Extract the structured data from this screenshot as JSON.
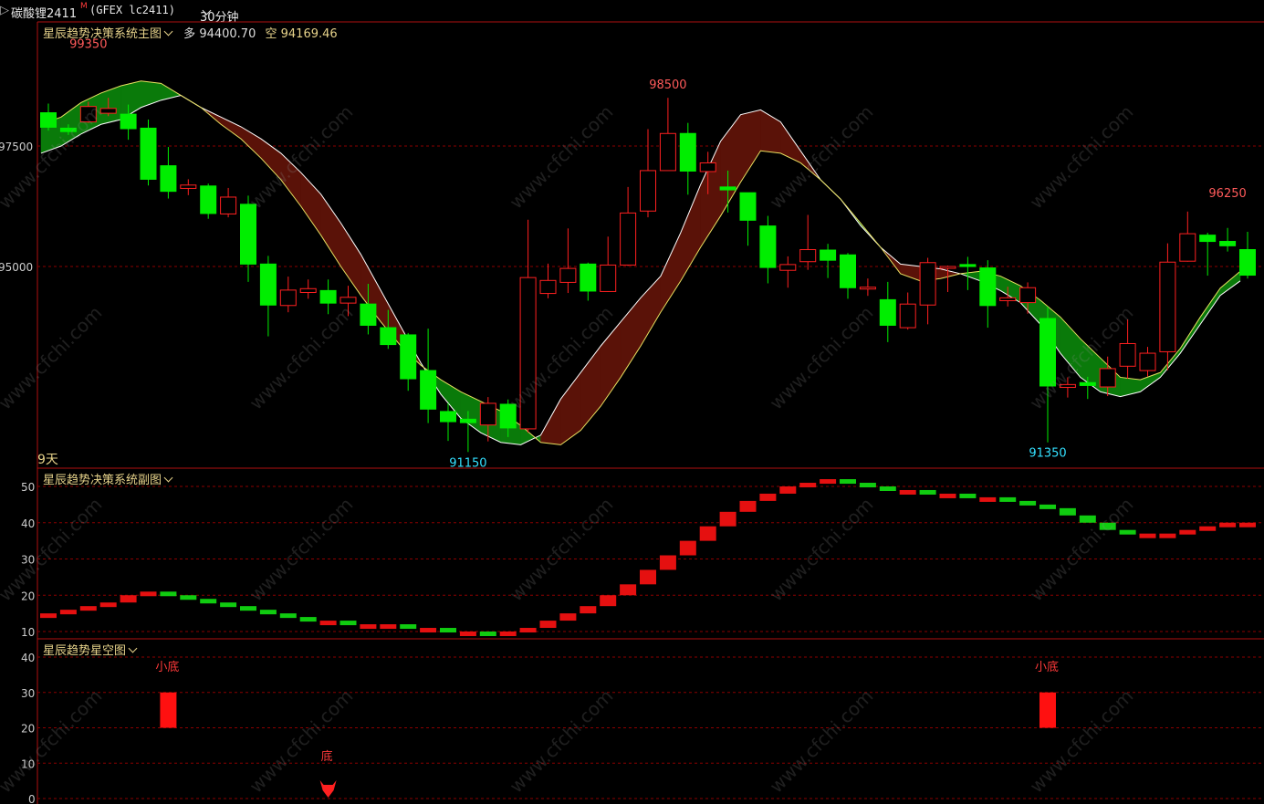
{
  "header": {
    "instrument": "碳酸锂2411",
    "badge": "M",
    "code": "(GFEX lc2411)",
    "period": "30分钟"
  },
  "main_panel": {
    "title": "星辰趋势决策系统主图",
    "long_label": "多",
    "long_value": "94400.70",
    "short_label": "空",
    "short_value": "94169.46",
    "corner_label": "9天",
    "y_labels": [
      "97500",
      "95000"
    ]
  },
  "sub_panel": {
    "title": "星辰趋势决策系统副图",
    "y_labels": [
      "50",
      "40",
      "30",
      "20",
      "10"
    ]
  },
  "star_panel": {
    "title": "星辰趋势星空图",
    "y_labels": [
      "40",
      "30",
      "20",
      "10",
      "0"
    ],
    "signals": [
      {
        "label": "小底",
        "value": 20
      },
      {
        "label": "小底",
        "value": 20
      }
    ],
    "bottom_signal": "底"
  },
  "watermark": "www.cfchi.com",
  "colors": {
    "up": "#ff2020",
    "down": "#00ee00",
    "bull_cloud": "#5a1208",
    "bear_cloud": "#0a7a0a",
    "grid": "#8b0000",
    "annotation_high": "#ff5a5a",
    "annotation_low": "#33e0ff",
    "title": "#e6d28a"
  },
  "chart_data": {
    "type": "candlestick",
    "y_range": [
      89500,
      100500
    ],
    "annotations": [
      {
        "label": "99350",
        "value": 99350,
        "kind": "high"
      },
      {
        "label": "91150",
        "value": 91150,
        "kind": "low"
      },
      {
        "label": "98500",
        "value": 98500,
        "kind": "high"
      },
      {
        "label": "91350",
        "value": 91350,
        "kind": "low"
      },
      {
        "label": "96250",
        "value": 96250,
        "kind": "high"
      }
    ],
    "candles": [
      [
        98200,
        97880,
        98380,
        97820
      ],
      [
        97880,
        97790,
        97950,
        97730
      ],
      [
        98000,
        98320,
        98420,
        97980
      ],
      [
        98180,
        98280,
        98500,
        98120
      ],
      [
        98170,
        97850,
        98360,
        97630
      ],
      [
        97880,
        96800,
        98050,
        96680
      ],
      [
        97100,
        96550,
        97480,
        96410
      ],
      [
        96620,
        96690,
        96810,
        96480
      ],
      [
        96680,
        96090,
        96720,
        95990
      ],
      [
        96090,
        96440,
        96630,
        96020
      ],
      [
        96300,
        95040,
        96470,
        94680
      ],
      [
        95060,
        94190,
        95220,
        93550
      ],
      [
        94190,
        94510,
        94790,
        94050
      ],
      [
        94460,
        94540,
        94730,
        94330
      ],
      [
        94510,
        94230,
        94730,
        94010
      ],
      [
        94240,
        94360,
        94600,
        93970
      ],
      [
        94230,
        93770,
        94640,
        93590
      ],
      [
        93740,
        93370,
        94100,
        93290
      ],
      [
        93590,
        92660,
        93620,
        92420
      ],
      [
        92850,
        92030,
        93710,
        91750
      ],
      [
        92000,
        91770,
        92160,
        91380
      ],
      [
        91840,
        91750,
        92000,
        91150
      ],
      [
        91710,
        92160,
        92290,
        91370
      ],
      [
        92150,
        91640,
        92240,
        91460
      ],
      [
        91630,
        94770,
        95970,
        91550
      ],
      [
        94440,
        94710,
        95060,
        94340
      ],
      [
        94670,
        94960,
        95790,
        94450
      ],
      [
        95060,
        94480,
        95080,
        94290
      ],
      [
        94480,
        95030,
        95620,
        94470
      ],
      [
        95030,
        96110,
        96650,
        95010
      ],
      [
        96150,
        96990,
        97850,
        96020
      ],
      [
        96990,
        97760,
        98500,
        97000
      ],
      [
        97770,
        96970,
        97980,
        96490
      ],
      [
        96970,
        97150,
        97380,
        96500
      ],
      [
        96660,
        96580,
        96990,
        96120
      ],
      [
        96540,
        95950,
        96520,
        95430
      ],
      [
        95850,
        94970,
        96050,
        94650
      ],
      [
        94920,
        95040,
        95210,
        94560
      ],
      [
        95100,
        95350,
        96070,
        94930
      ],
      [
        95350,
        95120,
        95470,
        94760
      ],
      [
        95250,
        94550,
        95280,
        94330
      ],
      [
        94570,
        94570,
        94750,
        94390
      ],
      [
        94320,
        93770,
        94680,
        93430
      ],
      [
        93730,
        94220,
        94460,
        93690
      ],
      [
        94200,
        95080,
        95180,
        93800
      ],
      [
        94990,
        95000,
        95020,
        94470
      ],
      [
        95050,
        94990,
        95200,
        94510
      ],
      [
        94980,
        94180,
        95130,
        93730
      ],
      [
        94290,
        94350,
        94580,
        94170
      ],
      [
        94250,
        94560,
        94670,
        94020
      ],
      [
        93930,
        92510,
        94170,
        91350
      ],
      [
        92490,
        92550,
        92700,
        92280
      ],
      [
        92600,
        92520,
        92710,
        92250
      ],
      [
        92500,
        92880,
        93130,
        92310
      ],
      [
        92930,
        93400,
        93900,
        92670
      ],
      [
        92840,
        93200,
        93330,
        92720
      ],
      [
        93230,
        95090,
        95480,
        92850
      ],
      [
        95110,
        95680,
        96140,
        95100
      ],
      [
        95660,
        95510,
        95700,
        94810
      ],
      [
        95530,
        95420,
        95800,
        95310
      ],
      [
        95360,
        94810,
        95720,
        94750
      ]
    ],
    "fast_line": [
      97350,
      97500,
      97750,
      97950,
      98050,
      98300,
      98450,
      98550,
      98300,
      98100,
      97900,
      97650,
      97350,
      96950,
      96500,
      95900,
      95250,
      94500,
      93750,
      93000,
      92350,
      91850,
      91550,
      91350,
      91300,
      91500,
      92250,
      92800,
      93350,
      93850,
      94350,
      94800,
      95700,
      96700,
      97600,
      98150,
      98250,
      98000,
      97400,
      96800,
      96400,
      95850,
      95400,
      95050,
      95000,
      94950,
      94850,
      94700,
      94500,
      94250,
      93800,
      93200,
      92700,
      92400,
      92300,
      92400,
      92700,
      93200,
      93800,
      94400,
      94700
    ],
    "slow_line": [
      97950,
      98100,
      98400,
      98600,
      98750,
      98850,
      98800,
      98550,
      98300,
      97950,
      97650,
      97250,
      96800,
      96250,
      95650,
      95000,
      94400,
      93850,
      93350,
      92950,
      92650,
      92400,
      92200,
      92000,
      91700,
      91350,
      91300,
      91600,
      92100,
      92700,
      93350,
      94050,
      94700,
      95400,
      96050,
      96750,
      97400,
      97350,
      97150,
      96800,
      96400,
      95900,
      95400,
      94850,
      94700,
      94750,
      94850,
      94900,
      94800,
      94600,
      94300,
      93950,
      93500,
      93100,
      92700,
      92650,
      92800,
      93300,
      93950,
      94550,
      94900
    ],
    "indicator": [
      15,
      16,
      17,
      18,
      20,
      21,
      20,
      19,
      18,
      17,
      16,
      15,
      14,
      13,
      13,
      12,
      12,
      12,
      11,
      11,
      10,
      10,
      9,
      10,
      11,
      13,
      15,
      17,
      20,
      23,
      27,
      31,
      35,
      39,
      43,
      46,
      48,
      50,
      51,
      52,
      51,
      50,
      49,
      49,
      48,
      48,
      47,
      47,
      46,
      45,
      44,
      42,
      40,
      38,
      37,
      37,
      37,
      38,
      39,
      40,
      40
    ],
    "star_bars": [
      {
        "index": 6,
        "value": 20,
        "label": "小底"
      },
      {
        "index": 50,
        "value": 20,
        "label": "小底"
      }
    ],
    "bottom_marker_index": 14
  }
}
